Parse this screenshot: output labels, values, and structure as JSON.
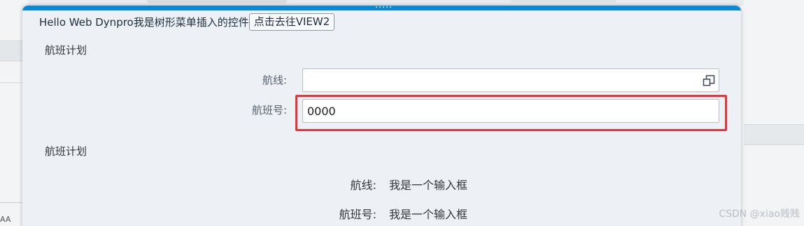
{
  "popup": {
    "greeting": "Hello Web Dynpro我是树形菜单插入的控件",
    "view2_button": "点击去往VIEW2"
  },
  "form_group": {
    "title": "航班计划",
    "route_label": "航线:",
    "route_value": "",
    "flight_label": "航班号:",
    "flight_value": "0000"
  },
  "display_group": {
    "title": "航班计划",
    "route_label": "航线:",
    "route_value": "我是一个输入框",
    "flight_label": "航班号:",
    "flight_value": "我是一个输入框"
  },
  "background": {
    "fragment_text": "AA"
  },
  "watermark": "CSDN @xiao贱贱",
  "colors": {
    "accent": "#0a8ad6",
    "highlight": "#e5343a",
    "popup_bg": "#edf1f5"
  },
  "icons": {
    "value_help": "value-help-icon"
  }
}
